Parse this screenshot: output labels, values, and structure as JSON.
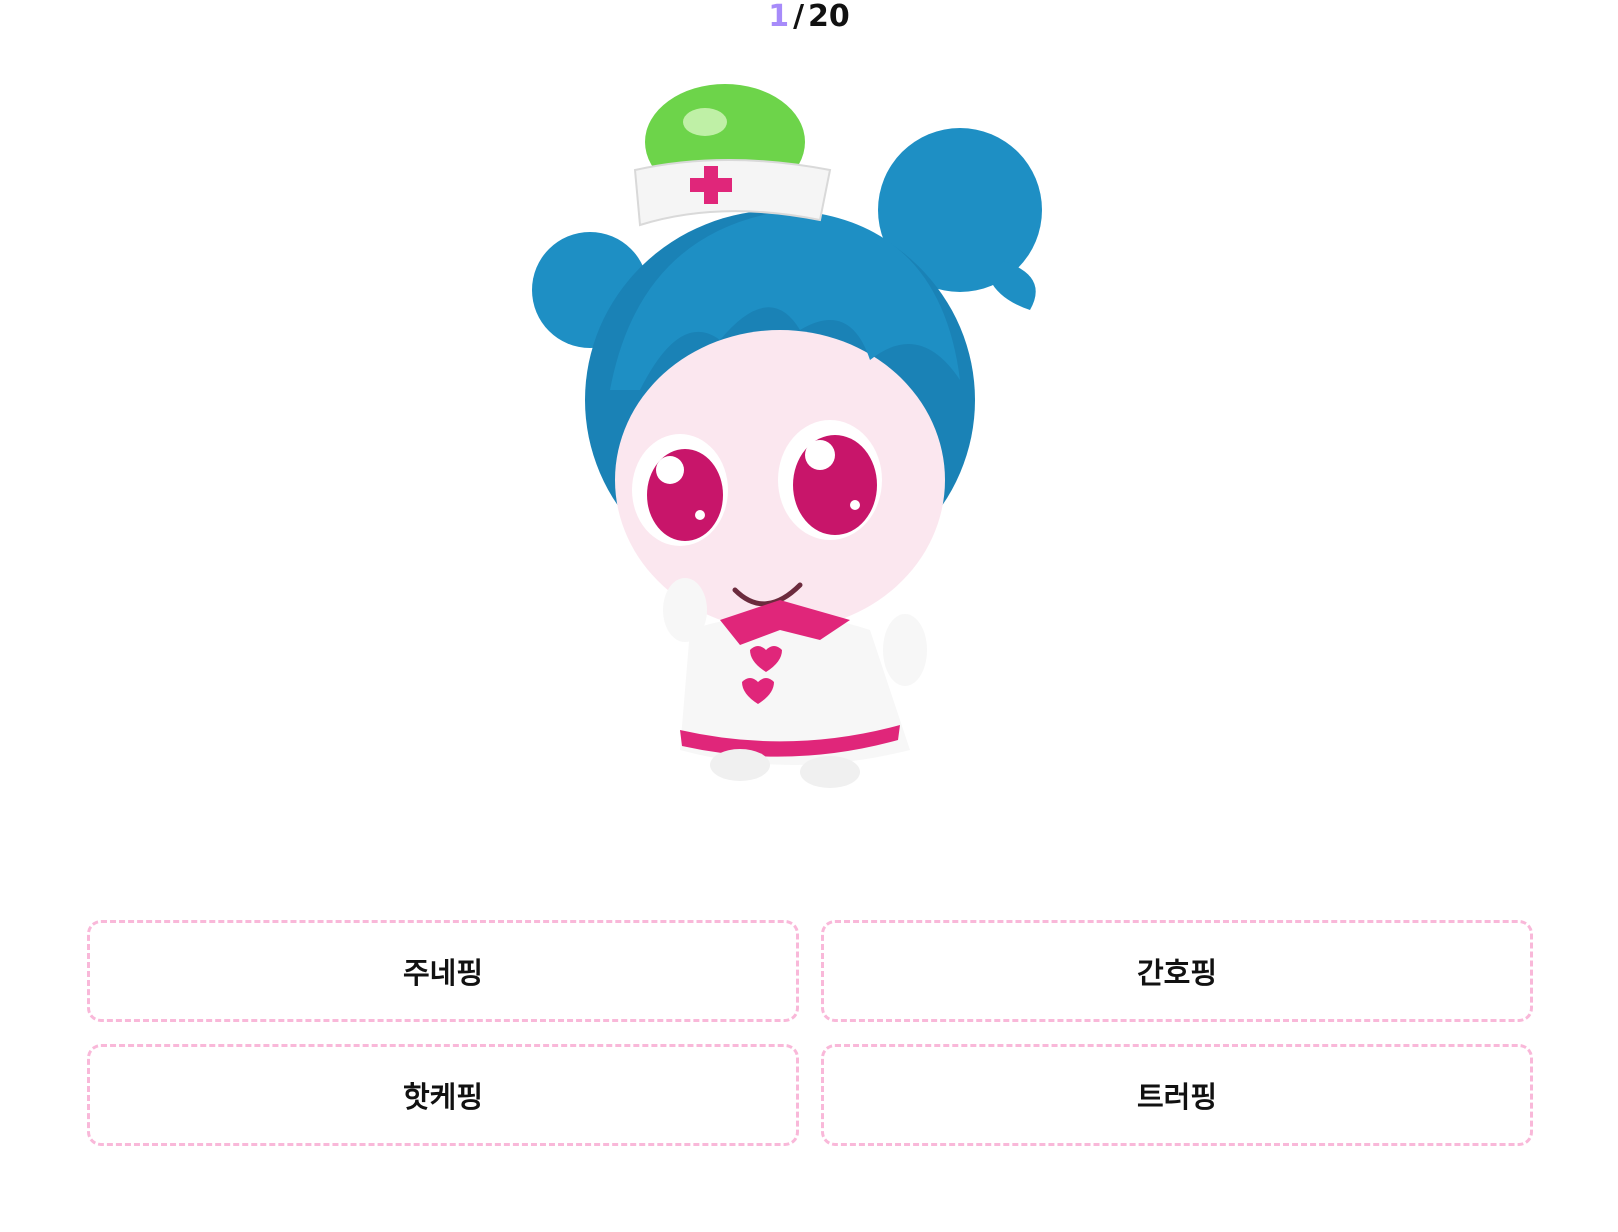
{
  "quiz": {
    "current": "1",
    "separator": "/",
    "total": "20"
  },
  "answers": [
    {
      "label": "주네핑"
    },
    {
      "label": "간호핑"
    },
    {
      "label": "핫케핑"
    },
    {
      "label": "트러핑"
    }
  ],
  "colors": {
    "accent": "#a78bfa",
    "answer_border": "#f9b8d9",
    "hair": "#1e8fc4",
    "hat_light": "#6dd44a",
    "pink": "#e0267a"
  }
}
